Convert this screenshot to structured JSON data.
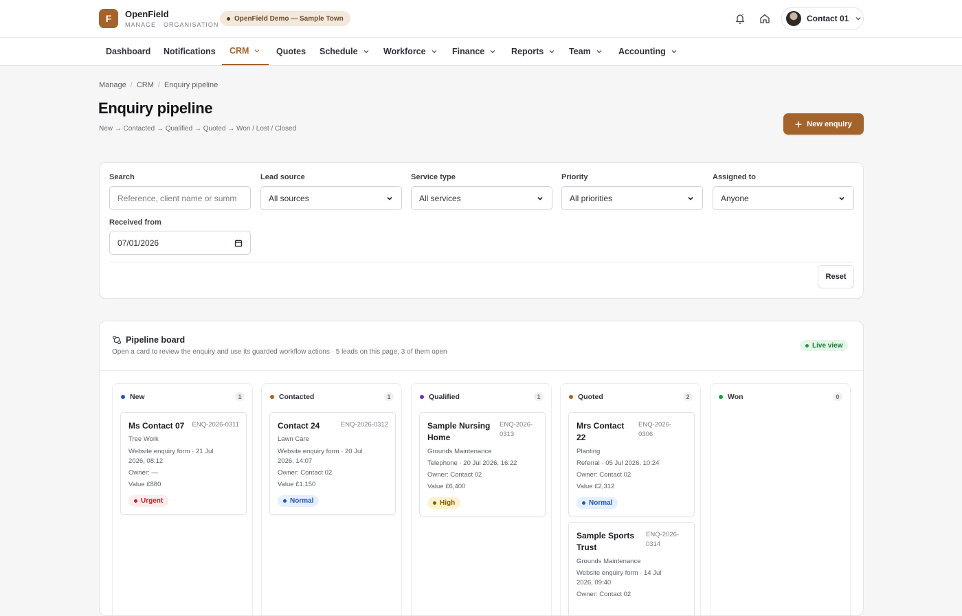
{
  "brand": {
    "letter": "F",
    "name": "OpenField",
    "subtitle": "MANAGE · ORGANISATION",
    "org_pill": "OpenField Demo — Sample Town"
  },
  "header": {
    "user_name": "Contact 01",
    "bell_icon": "bell-icon",
    "home_icon": "home-icon"
  },
  "nav": [
    {
      "label": "Dashboard"
    },
    {
      "label": "Notifications"
    },
    {
      "label": "CRM"
    },
    {
      "label": "Quotes"
    },
    {
      "label": "Schedule"
    },
    {
      "label": "Workforce"
    },
    {
      "label": "Finance"
    },
    {
      "label": "Reports"
    },
    {
      "label": "Team"
    },
    {
      "label": "Accounting"
    }
  ],
  "breadcrumb": [
    "Manage",
    "CRM",
    "Enquiry pipeline"
  ],
  "page": {
    "title": "Enquiry pipeline",
    "flow": "New → Contacted → Qualified → Quoted → Won / Lost / Closed",
    "new_button": "New enquiry",
    "accent": "#a5632c"
  },
  "filters": {
    "search": {
      "label": "Search",
      "placeholder": "Reference, client name or summ"
    },
    "lead_source": {
      "label": "Lead source",
      "value": "All sources"
    },
    "service_type": {
      "label": "Service type",
      "value": "All services"
    },
    "priority": {
      "label": "Priority",
      "value": "All priorities"
    },
    "assigned_to": {
      "label": "Assigned to",
      "value": "Anyone"
    },
    "received_from": {
      "label": "Received from",
      "value": "07/01/2026"
    },
    "reset_label": "Reset"
  },
  "board": {
    "title": "Pipeline board",
    "subtitle": "Open a card to review the enquiry and use its guarded workflow actions · 5 leads on this page, 3 of them open",
    "live_label": "Live view",
    "columns": [
      {
        "name": "New",
        "count": "1",
        "color": "#2456b8",
        "cards": [
          {
            "name": "Ms Contact 07",
            "ref": "ENQ-2026-0311",
            "service": "Tree Work",
            "source1": "Website enquiry form · 21 Jul",
            "source2": "2026, 08:12",
            "owner": "Owner: —",
            "value": "Value £880",
            "priority": "Urgent"
          }
        ]
      },
      {
        "name": "Contacted",
        "count": "1",
        "color": "#a5632c",
        "cards": [
          {
            "name": "Contact 24",
            "ref": "ENQ-2026-0312",
            "service": "Lawn Care",
            "source1": "Website enquiry form · 20 Jul",
            "source2": "2026, 14:07",
            "owner": "Owner: Contact 02",
            "value": "Value £1,150",
            "priority": "Normal"
          }
        ]
      },
      {
        "name": "Qualified",
        "count": "1",
        "color": "#6b2fbf",
        "cards": [
          {
            "name1": "Sample Nursing",
            "name2": "Home",
            "ref1": "ENQ-2026-",
            "ref2": "0313",
            "service": "Grounds Maintenance",
            "source1": "Telephone · 20 Jul 2026, 16:22",
            "owner": "Owner: Contact 02",
            "value": "Value £6,400",
            "priority": "High"
          }
        ]
      },
      {
        "name": "Quoted",
        "count": "2",
        "color": "#a5632c",
        "cards": [
          {
            "name1": "Mrs Contact",
            "name2": "22",
            "ref1": "ENQ-2026-",
            "ref2": "0306",
            "service": "Planting",
            "source1": "Referral · 05 Jul 2026, 10:24",
            "owner": "Owner: Contact 02",
            "value": "Value £2,312",
            "priority": "Normal"
          },
          {
            "name1": "Sample Sports",
            "name2": "Trust",
            "ref1": "ENQ-2026-",
            "ref2": "0314",
            "service": "Grounds Maintenance",
            "source1": "Website enquiry form · 14 Jul",
            "source2": "2026, 09:40",
            "owner": "Owner: Contact 02"
          }
        ]
      },
      {
        "name": "Won",
        "count": "0",
        "color": "#1e9a45",
        "cards": []
      }
    ]
  }
}
